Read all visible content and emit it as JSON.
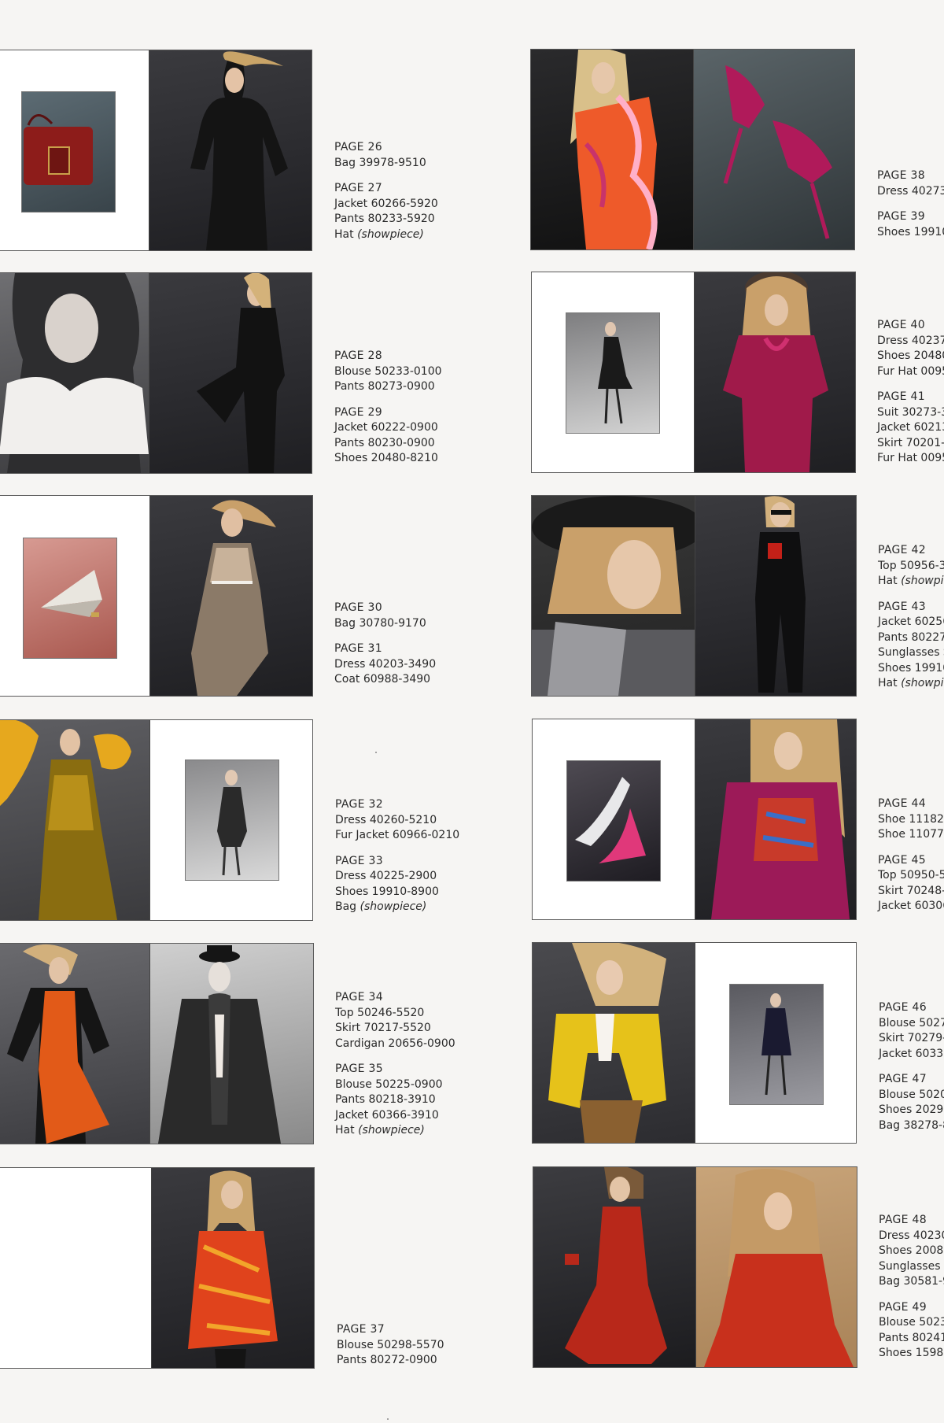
{
  "captions": {
    "p26_27": [
      {
        "page": "PAGE 26",
        "items": [
          "Bag 39978-9510"
        ]
      },
      {
        "page": "PAGE 27",
        "items": [
          "Jacket 60266-5920",
          "Pants 80233-5920",
          "Hat"
        ],
        "notes": [
          "",
          "",
          "(showpiece)"
        ]
      }
    ],
    "p28_29": [
      {
        "page": "PAGE 28",
        "items": [
          "Blouse 50233-0100",
          "Pants 80273-0900"
        ]
      },
      {
        "page": "PAGE 29",
        "items": [
          "Jacket 60222-0900",
          "Pants 80230-0900",
          "Shoes 20480-8210"
        ]
      }
    ],
    "p30_31": [
      {
        "page": "PAGE 30",
        "items": [
          "Bag 30780-9170"
        ]
      },
      {
        "page": "PAGE 31",
        "items": [
          "Dress 40203-3490",
          "Coat 60988-3490"
        ]
      }
    ],
    "p32_33": [
      {
        "page": "PAGE 32",
        "items": [
          "Dress 40260-5210",
          "Fur Jacket 60966-0210"
        ]
      },
      {
        "page": "PAGE 33",
        "items": [
          "Dress 40225-2900",
          "Shoes 19910-8900",
          "Bag"
        ],
        "notes": [
          "",
          "",
          "(showpiece)"
        ]
      }
    ],
    "p34_35": [
      {
        "page": "PAGE 34",
        "items": [
          "Top 50246-5520",
          "Skirt 70217-5520",
          "Cardigan 20656-0900"
        ]
      },
      {
        "page": "PAGE 35",
        "items": [
          "Blouse 50225-0900",
          "Pants 80218-3910",
          "Jacket 60366-3910",
          "Hat"
        ],
        "notes": [
          "",
          "",
          "",
          "(showpiece)"
        ]
      }
    ],
    "p37": [
      {
        "page": "PAGE 37",
        "items": [
          "Blouse 50298-5570",
          "Pants 80272-0900"
        ]
      }
    ],
    "p38_39": [
      {
        "page": "PAGE 38",
        "items": [
          "Dress 40273-"
        ]
      },
      {
        "page": "PAGE 39",
        "items": [
          "Shoes 19910"
        ]
      }
    ],
    "p40_41": [
      {
        "page": "PAGE 40",
        "items": [
          "Dress 40237-",
          "Shoes 20480",
          "Fur Hat 0095"
        ]
      },
      {
        "page": "PAGE 41",
        "items": [
          "Suit 30273-3",
          "Jacket 60213",
          "Skirt 70201-3",
          "Fur Hat 0095"
        ]
      }
    ],
    "p42_43": [
      {
        "page": "PAGE 42",
        "items": [
          "Top 50956-3",
          "Hat"
        ],
        "notes": [
          "",
          "(showpie"
        ]
      },
      {
        "page": "PAGE 43",
        "items": [
          "Jacket 60256",
          "Pants 80227-",
          "Sunglasses S8",
          "Shoes 19910",
          "Hat"
        ],
        "notes": [
          "",
          "",
          "",
          "",
          "(showpie"
        ]
      }
    ],
    "p44_45": [
      {
        "page": "PAGE 44",
        "items": [
          "Shoe 11182-",
          "Shoe 11077-"
        ]
      },
      {
        "page": "PAGE 45",
        "items": [
          "Top 50950-5",
          "Skirt 70248-2",
          "Jacket 60306"
        ]
      }
    ],
    "p46_47": [
      {
        "page": "PAGE 46",
        "items": [
          "Blouse 5027",
          "Skirt 70279-",
          "Jacket 60331"
        ]
      },
      {
        "page": "PAGE 47",
        "items": [
          "Blouse 5020",
          "Shoes 20292",
          "Bag 38278-8"
        ]
      }
    ],
    "p48_49": [
      {
        "page": "PAGE 48",
        "items": [
          "Dress 40230",
          "Shoes 20080",
          "Sunglasses Sl",
          "Bag 30581-9"
        ]
      },
      {
        "page": "PAGE 49",
        "items": [
          "Blouse 5023",
          "Pants 80241-",
          "Shoes 15980"
        ]
      }
    ]
  },
  "colors": {
    "paper": "#f6f5f3",
    "text": "#2a2a2a",
    "frame": "#5a5a5a"
  }
}
